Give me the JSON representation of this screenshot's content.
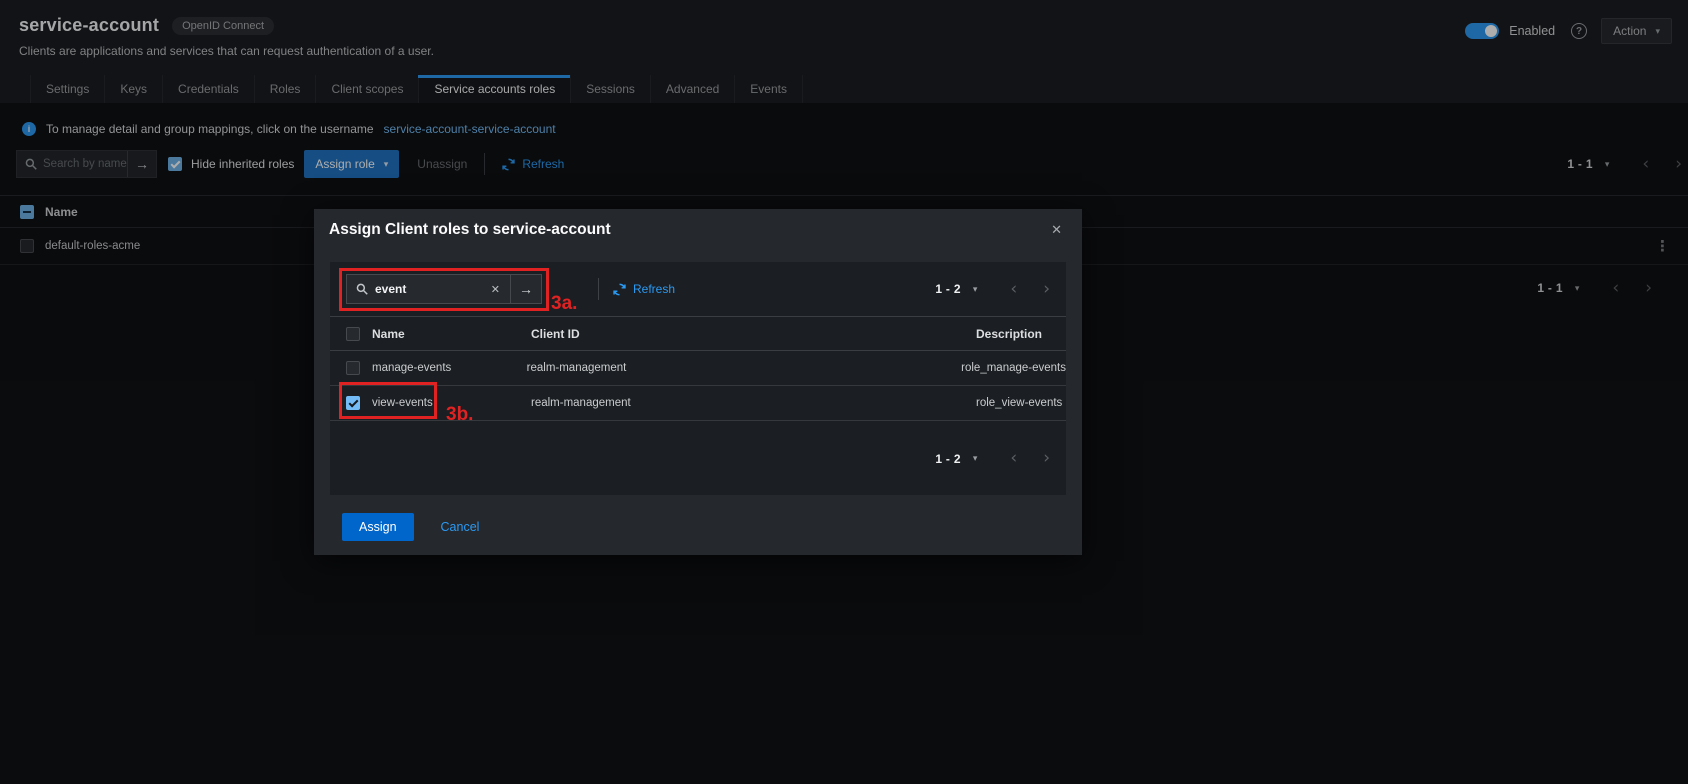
{
  "page": {
    "title": "service-account",
    "protocol_badge": "OpenID Connect",
    "subtitle": "Clients are applications and services that can request authentication of a user.",
    "enabled_label": "Enabled",
    "action_button": "Action"
  },
  "tabs": [
    {
      "label": "Settings",
      "active": false
    },
    {
      "label": "Keys",
      "active": false
    },
    {
      "label": "Credentials",
      "active": false
    },
    {
      "label": "Roles",
      "active": false
    },
    {
      "label": "Client scopes",
      "active": false
    },
    {
      "label": "Service accounts roles",
      "active": true
    },
    {
      "label": "Sessions",
      "active": false
    },
    {
      "label": "Advanced",
      "active": false
    },
    {
      "label": "Events",
      "active": false
    }
  ],
  "info_banner": {
    "text": "To manage detail and group mappings, click on the username",
    "link_text": "service-account-service-account"
  },
  "toolbar": {
    "search_placeholder": "Search by name",
    "hide_inherited_label": "Hide inherited roles",
    "assign_role_button": "Assign role",
    "unassign_button": "Unassign",
    "refresh_link": "Refresh",
    "pagination_range": "1 - 1"
  },
  "roles_table": {
    "name_header": "Name",
    "rows": [
      {
        "name": "default-roles-acme"
      }
    ],
    "pagination_range": "1 - 1"
  },
  "modal": {
    "title": "Assign Client roles to service-account",
    "search_value": "event",
    "refresh_link": "Refresh",
    "pagination_top": "1 - 2",
    "pagination_bottom": "1 - 2",
    "columns": {
      "name": "Name",
      "client_id": "Client ID",
      "description": "Description"
    },
    "rows": [
      {
        "name": "manage-events",
        "client_id": "realm-management",
        "description": "role_manage-events",
        "checked": false
      },
      {
        "name": "view-events",
        "client_id": "realm-management",
        "description": "role_view-events",
        "checked": true
      }
    ],
    "assign_button": "Assign",
    "cancel_link": "Cancel"
  },
  "annotations": {
    "step_3a": "3a.",
    "step_3b": "3b."
  },
  "icons": {
    "caret_down": "▾",
    "chevron_left": "‹",
    "chevron_right": "›",
    "arrow_right": "→",
    "kebab": "⋮",
    "close": "✕",
    "clear": "✕",
    "question_mark": "?",
    "info": "i"
  },
  "colors": {
    "accent_blue": "#2b9af3",
    "primary_button": "#0066cc",
    "link_light": "#73bcf7",
    "checkbox_checked": "#73bcf7",
    "annotation_red": "#e02222",
    "header_bg": "#1b1d21",
    "modal_bg": "#25282d"
  }
}
